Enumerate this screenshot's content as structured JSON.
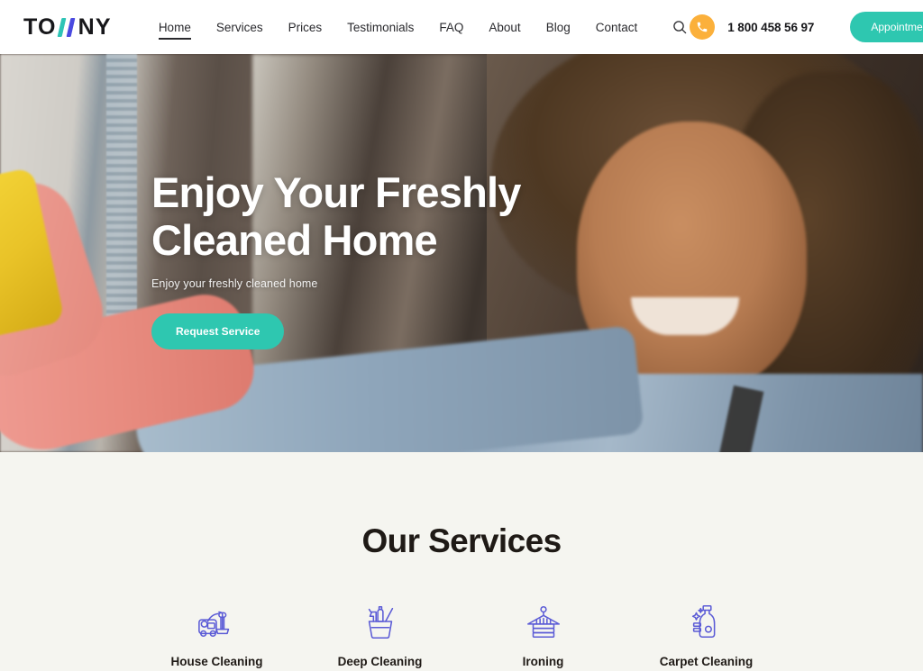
{
  "brand": {
    "name_part1": "TO",
    "name_part2": "NY",
    "logo_icon": "towny-w-logo",
    "accent_teal": "#2EC7B0",
    "accent_blue": "#4A4AE0",
    "accent_amber": "#FBB03B"
  },
  "nav": {
    "items": [
      {
        "label": "Home",
        "active": true
      },
      {
        "label": "Services",
        "active": false
      },
      {
        "label": "Prices",
        "active": false
      },
      {
        "label": "Testimonials",
        "active": false
      },
      {
        "label": "FAQ",
        "active": false
      },
      {
        "label": "About",
        "active": false
      },
      {
        "label": "Blog",
        "active": false
      },
      {
        "label": "Contact",
        "active": false
      }
    ],
    "search_icon": "search-icon"
  },
  "header": {
    "phone_icon": "phone-icon",
    "phone_number": "1 800 458 56 97",
    "appointment_label": "Appointment"
  },
  "hero": {
    "heading": "Enjoy Your Freshly Cleaned Home",
    "subheading": "Enjoy your freshly cleaned home",
    "cta_label": "Request Service"
  },
  "services": {
    "title": "Our Services",
    "items": [
      {
        "icon": "vacuum-cleaner-icon",
        "label": "House Cleaning"
      },
      {
        "icon": "cleaning-bucket-icon",
        "label": "Deep Cleaning"
      },
      {
        "icon": "laundry-hanger-icon",
        "label": "Ironing"
      },
      {
        "icon": "detergent-bottle-icon",
        "label": "Carpet Cleaning"
      }
    ]
  }
}
